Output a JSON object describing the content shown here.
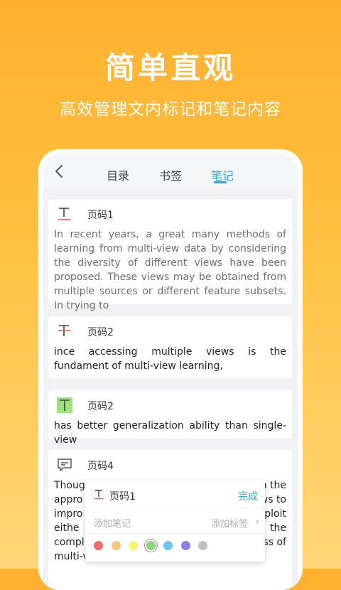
{
  "headline": "简单直观",
  "subline": "高效管理文内标记和笔记内容",
  "tabs": [
    {
      "label": "目录"
    },
    {
      "label": "书签"
    },
    {
      "label": "笔记"
    }
  ],
  "notes": [
    {
      "page": "页码1",
      "icon": "underline-text-icon",
      "text": "In recent years, a great many methods of learning from multi-view data by considering the diversity of different views have been proposed. These views may be obtained from multiple sources or different feature subsets. In trying to"
    },
    {
      "page": "页码2",
      "icon": "strikethrough-text-icon",
      "text": "ince accessing multiple views is the fundament of multi-view learning,"
    },
    {
      "page": "页码2",
      "icon": "highlight-text-icon",
      "text": "has better generalization ability than single-view"
    },
    {
      "page": "页码4",
      "icon": "comment-icon",
      "text": "Though the approaches ... views to improve ... exploit either ... the complementary ... ness of multi-view learning."
    }
  ],
  "note4_lines": {
    "left": [
      "Thoug",
      "appro",
      "impro",
      "eithe",
      "compl",
      "multi-view learning."
    ],
    "right": [
      "n the",
      "ws to",
      "exploit",
      "the",
      "ess of"
    ]
  },
  "popup": {
    "page": "页码1",
    "done": "完成",
    "add_note": "添加笔记",
    "add_tag": "添加标签"
  },
  "colors": {
    "accent": "#2BA7E8",
    "palette": [
      "#F26B6B",
      "#FBC77A",
      "#F9F275",
      "#8BD47E",
      "#6EC6F0",
      "#8D7FF2",
      "#C0C0C0"
    ],
    "selected_index": 3
  }
}
